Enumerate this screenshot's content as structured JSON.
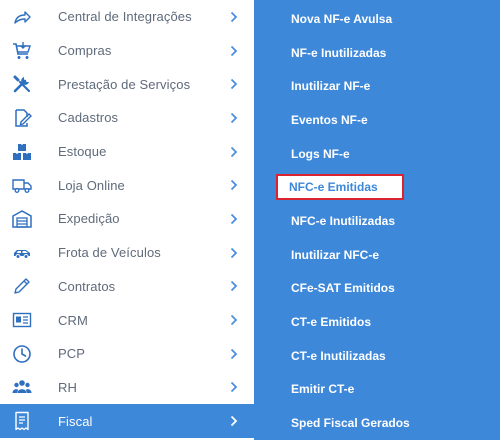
{
  "colors": {
    "accent": "#3e88da",
    "menu_text": "#5f6a7a",
    "highlight_border": "#d9232e"
  },
  "left_menu": {
    "items": [
      {
        "label": "Central de Integrações",
        "icon": "share-arrow-icon"
      },
      {
        "label": "Compras",
        "icon": "shopping-cart-icon"
      },
      {
        "label": "Prestação de Serviços",
        "icon": "tools-icon"
      },
      {
        "label": "Cadastros",
        "icon": "edit-document-icon"
      },
      {
        "label": "Estoque",
        "icon": "boxes-icon"
      },
      {
        "label": "Loja Online",
        "icon": "delivery-truck-icon"
      },
      {
        "label": "Expedição",
        "icon": "warehouse-icon"
      },
      {
        "label": "Frota de Veículos",
        "icon": "car-icon"
      },
      {
        "label": "Contratos",
        "icon": "pen-icon"
      },
      {
        "label": "CRM",
        "icon": "id-card-icon"
      },
      {
        "label": "PCP",
        "icon": "clock-icon"
      },
      {
        "label": "RH",
        "icon": "users-icon"
      },
      {
        "label": "Fiscal",
        "icon": "receipt-icon",
        "active": true
      }
    ]
  },
  "submenu": {
    "items": [
      {
        "label": "Nova NF-e Avulsa"
      },
      {
        "label": "NF-e Inutilizadas"
      },
      {
        "label": "Inutilizar NF-e"
      },
      {
        "label": "Eventos NF-e"
      },
      {
        "label": "Logs NF-e"
      },
      {
        "label": "NFC-e Emitidas",
        "highlighted": true
      },
      {
        "label": "NFC-e Inutilizadas"
      },
      {
        "label": "Inutilizar NFC-e"
      },
      {
        "label": "CFe-SAT Emitidos"
      },
      {
        "label": "CT-e Emitidos"
      },
      {
        "label": "CT-e Inutilizadas"
      },
      {
        "label": "Emitir CT-e"
      },
      {
        "label": "Sped Fiscal Gerados"
      }
    ]
  }
}
